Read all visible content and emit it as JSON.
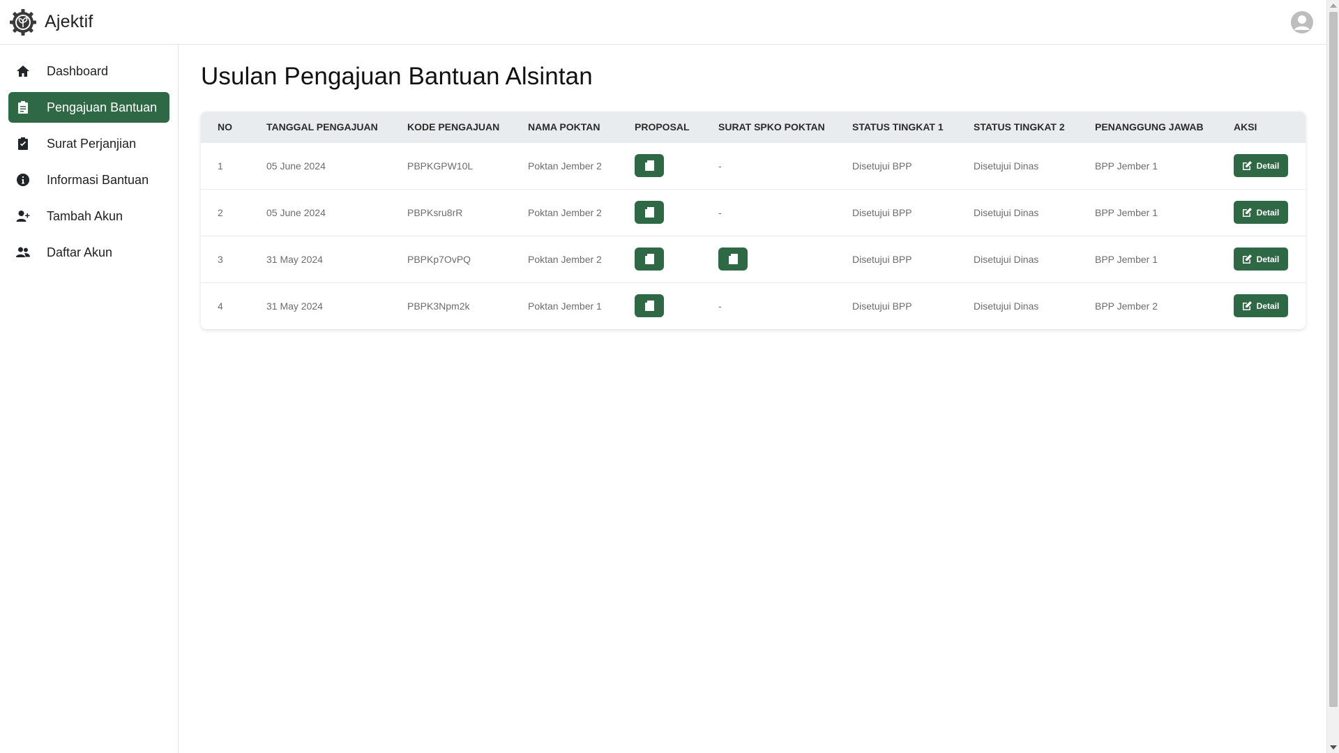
{
  "app": {
    "name": "Ajektif"
  },
  "sidebar": {
    "items": [
      {
        "label": "Dashboard",
        "icon": "home-icon",
        "active": false
      },
      {
        "label": "Pengajuan Bantuan",
        "icon": "clipboard-icon",
        "active": true
      },
      {
        "label": "Surat Perjanjian",
        "icon": "clipboard-check-icon",
        "active": false
      },
      {
        "label": "Informasi Bantuan",
        "icon": "info-circle-icon",
        "active": false
      },
      {
        "label": "Tambah Akun",
        "icon": "user-plus-icon",
        "active": false
      },
      {
        "label": "Daftar Akun",
        "icon": "users-icon",
        "active": false
      }
    ]
  },
  "main": {
    "title": "Usulan Pengajuan Bantuan Alsintan",
    "table": {
      "headers": {
        "no": "NO",
        "tanggal": "TANGGAL PENGAJUAN",
        "kode": "KODE PENGAJUAN",
        "poktan": "NAMA POKTAN",
        "proposal": "PROPOSAL",
        "spko": "SURAT SPKO POKTAN",
        "status1": "STATUS TINGKAT 1",
        "status2": "STATUS TINGKAT 2",
        "pj": "PENANGGUNG JAWAB",
        "aksi": "AKSI"
      },
      "rows": [
        {
          "no": "1",
          "tanggal": "05 June 2024",
          "kode": "PBPKGPW10L",
          "poktan": "Poktan Jember 2",
          "proposal": true,
          "spko": "-",
          "status1": "Disetujui BPP",
          "status2": "Disetujui Dinas",
          "pj": "BPP Jember 1",
          "aksi": "Detail"
        },
        {
          "no": "2",
          "tanggal": "05 June 2024",
          "kode": "PBPKsru8rR",
          "poktan": "Poktan Jember 2",
          "proposal": true,
          "spko": "-",
          "status1": "Disetujui BPP",
          "status2": "Disetujui Dinas",
          "pj": "BPP Jember 1",
          "aksi": "Detail"
        },
        {
          "no": "3",
          "tanggal": "31 May 2024",
          "kode": "PBPKp7OvPQ",
          "poktan": "Poktan Jember 2",
          "proposal": true,
          "spko": "file",
          "status1": "Disetujui BPP",
          "status2": "Disetujui Dinas",
          "pj": "BPP Jember 1",
          "aksi": "Detail"
        },
        {
          "no": "4",
          "tanggal": "31 May 2024",
          "kode": "PBPK3Npm2k",
          "poktan": "Poktan Jember 1",
          "proposal": true,
          "spko": "-",
          "status1": "Disetujui BPP",
          "status2": "Disetujui Dinas",
          "pj": "BPP Jember 2",
          "aksi": "Detail"
        }
      ]
    }
  },
  "colors": {
    "accent": "#2f6845",
    "header_bg": "#e9ecef"
  }
}
